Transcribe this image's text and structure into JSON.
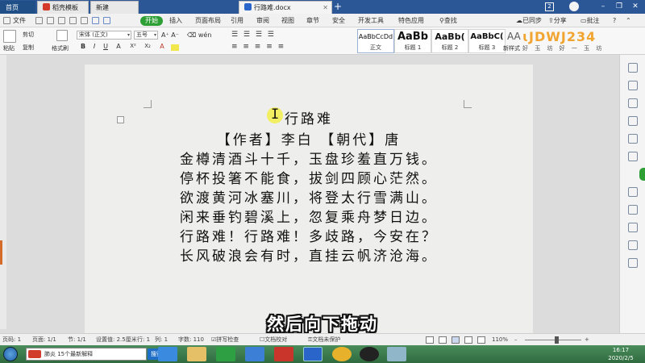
{
  "tabs": [
    {
      "label": "首页",
      "icon": "home-icon"
    },
    {
      "label": "稻壳模板",
      "icon": "docer-icon"
    },
    {
      "label": "新建",
      "icon": "new-icon"
    },
    {
      "label": "行路难.docx",
      "icon": "word-doc-icon"
    }
  ],
  "tabbar": {
    "badge": "2"
  },
  "menu": {
    "file": "文件",
    "items": [
      "开始",
      "插入",
      "页面布局",
      "引用",
      "审阅",
      "视图",
      "章节",
      "安全",
      "开发工具",
      "特色应用"
    ],
    "search": "查找",
    "sync": "已同步",
    "share": "分享",
    "comment": "批注"
  },
  "ribbon": {
    "paste": "粘贴",
    "cut": "剪切",
    "copy": "复制",
    "format_painter": "格式刷",
    "font_name": "宋体 (正文)",
    "font_size": "五号",
    "format_buttons": [
      "B",
      "I",
      "U",
      "A",
      "X²",
      "X₂",
      "A"
    ],
    "styles": [
      {
        "sample": "AaBbCcDd",
        "name": "正文"
      },
      {
        "sample": "AaBb",
        "name": "标题 1"
      },
      {
        "sample": "AaBb(",
        "name": "标题 2"
      },
      {
        "sample": "AaBbC(",
        "name": "标题 3"
      }
    ],
    "new_style": "新样式",
    "watermark_text": "ɩJDWJ234",
    "watermark_sub": "好 玉 坊 好 一 玉 坊"
  },
  "document": {
    "title": "行路难",
    "author_line": "【作者】李白 【朝代】唐",
    "lines": [
      "金樽清酒斗十千，玉盘珍羞直万钱。",
      "停杯投箸不能食，拔剑四顾心茫然。",
      "欲渡黄河冰塞川，将登太行雪满山。",
      "闲来垂钓碧溪上，忽复乘舟梦日边。",
      "行路难！行路难！多歧路，今安在？",
      "长风破浪会有时，直挂云帆济沧海。"
    ]
  },
  "subtitle": "然后向下拖动",
  "status": {
    "page": "页码: 1",
    "pages": "页面: 1/1",
    "section": "节: 1/1",
    "position": "设置值: 2.5厘米",
    "row": "行: 1",
    "col": "列: 1",
    "words": "字数: 110",
    "spell": "拼写检查",
    "proof": "文档校对",
    "unprotected": "文档未保护",
    "zoom": "110%",
    "zoom_level": 0.55
  },
  "taskbar": {
    "search_text": "肺炎 15个最新解释",
    "search_button": "搜索一下",
    "clock_line1": "16:17",
    "date": "2020/2/5"
  },
  "colors": {
    "tab_blue": "#2b5797",
    "start_green": "#2e9f35",
    "highlight_yellow": "#f2ef4a"
  }
}
